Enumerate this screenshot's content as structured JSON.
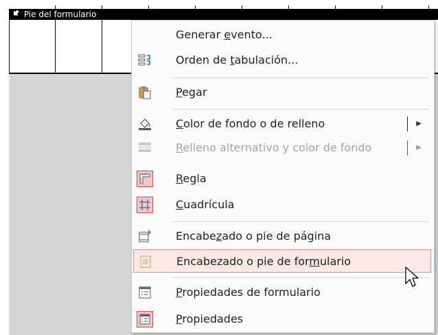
{
  "section_bar": {
    "title": "Pie del formulario"
  },
  "menu": {
    "items": [
      {
        "id": "generar-evento",
        "pre": "Generar ",
        "key": "e",
        "post": "vento...",
        "icon": "none"
      },
      {
        "id": "orden-tabulacion",
        "pre": "Orden de ",
        "key": "t",
        "post": "abulación...",
        "icon": "tab-order-icon"
      },
      {
        "id": "pegar",
        "pre": "",
        "key": "P",
        "post": "egar",
        "icon": "paste-icon"
      },
      {
        "id": "color-fondo",
        "pre": "",
        "key": "C",
        "post": "olor de fondo o de relleno",
        "icon": "fill-color-icon",
        "submenu": "▶"
      },
      {
        "id": "relleno-alternativo",
        "pre": "",
        "key": "R",
        "post": "elleno alternativo y color de fondo",
        "icon": "alternate-fill-icon",
        "submenu": "▶",
        "disabled": true
      },
      {
        "id": "regla",
        "pre": "",
        "key": "R",
        "post": "egla",
        "icon": "ruler-icon",
        "checked": true
      },
      {
        "id": "cuadricula",
        "pre": "",
        "key": "C",
        "post": "uadrícula",
        "icon": "grid-icon",
        "checked": true
      },
      {
        "id": "encabezado-pagina",
        "pre": "Encabe",
        "key": "z",
        "post": "ado o pie de página",
        "icon": "page-header-icon"
      },
      {
        "id": "encabezado-formulario",
        "pre": "Encabezado o pie de for",
        "key": "m",
        "post": "ulario",
        "icon": "form-header-icon",
        "highlighted": true
      },
      {
        "id": "propiedades-formulario",
        "pre": "",
        "key": "P",
        "post": "ropiedades de formulario",
        "icon": "form-properties-icon"
      },
      {
        "id": "propiedades",
        "pre": "",
        "key": "P",
        "post": "ropiedades",
        "icon": "properties-icon",
        "checked": true
      }
    ]
  },
  "colors": {
    "highlight_bg": "#fde8e8",
    "highlight_border": "#e28b8b",
    "checked_bg": "#f6c6c6",
    "checked_border": "#d14b4b",
    "designer_grey": "#d6d6d6"
  }
}
